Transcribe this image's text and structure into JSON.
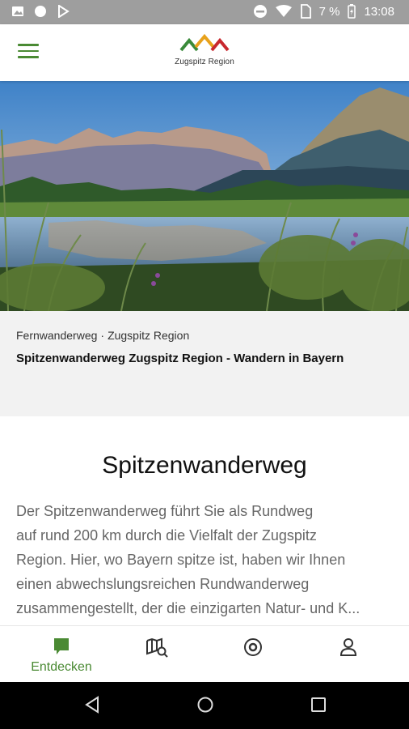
{
  "status_bar": {
    "battery": "7 %",
    "time": "13:08"
  },
  "app_bar": {
    "logo_text": "Zugspitz Region",
    "logo_colors": [
      "#3a8a3a",
      "#e8a21c",
      "#c8282e"
    ]
  },
  "hero": {
    "image_description_icon": "mountain-lake-photo"
  },
  "info": {
    "category": "Fernwanderweg",
    "separator": "·",
    "region": "Zugspitz Region",
    "subtitle": "Spitzenwanderweg Zugspitz Region - Wandern in Bayern"
  },
  "content": {
    "heading": "Spitzenwanderweg",
    "description_lines": [
      "Der Spitzenwanderweg führt Sie als Rundweg",
      "auf rund 200 km durch die Vielfalt der Zugspitz",
      "Region. Hier, wo Bayern spitze ist, haben wir Ihnen",
      "einen abwechslungsreichen Rundwanderweg",
      "zusammengestellt, der die einzigarten Natur- und K..."
    ]
  },
  "bottom_nav": {
    "items": [
      {
        "label": "Entdecken",
        "icon": "discover-icon",
        "active": true
      },
      {
        "label": "",
        "icon": "map-search-icon",
        "active": false
      },
      {
        "label": "",
        "icon": "target-icon",
        "active": false
      },
      {
        "label": "",
        "icon": "profile-icon",
        "active": false
      }
    ],
    "active_color": "#4a8a33"
  }
}
